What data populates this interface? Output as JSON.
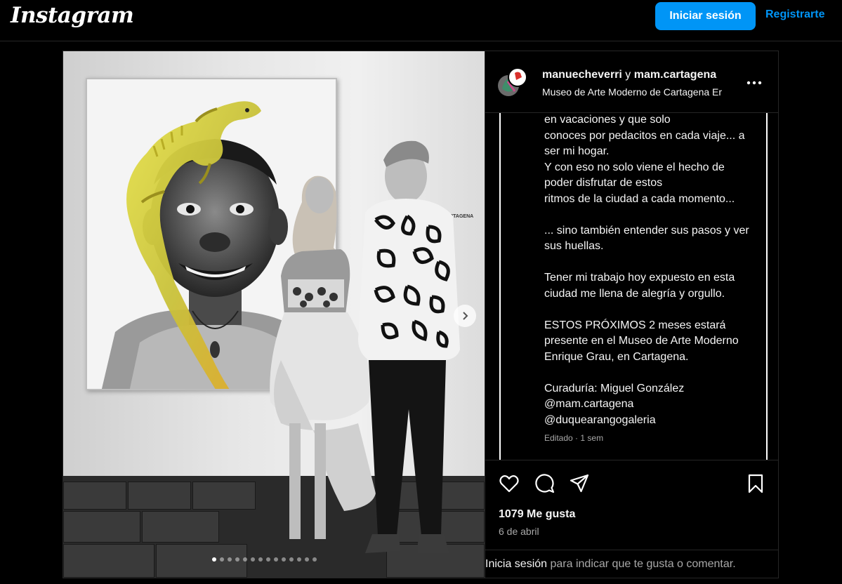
{
  "app": {
    "logo": "Instagram"
  },
  "header": {
    "login_label": "Iniciar sesión",
    "register_label": "Registrarte"
  },
  "post": {
    "author": "manuecheverri",
    "joiner": "y",
    "coauthor": "mam.cartagena",
    "location": "Museo de Arte Moderno de Cartagena Er",
    "caption_lines": [
      "en vacaciones y que solo",
      "conoces por pedacitos en cada viaje... a",
      "ser mi hogar.",
      "Y con eso no solo viene el hecho de",
      "poder disfrutar de estos",
      "ritmos de la ciudad a cada momento...",
      "",
      "... sino también entender sus pasos y ver",
      "sus huellas.",
      "",
      "Tener mi trabajo hoy expuesto en esta",
      "ciudad me llena de alegría y orgullo.",
      "",
      "ESTOS PRÓXIMOS 2 meses estará",
      "presente en el Museo de Arte Moderno",
      "Enrique Grau, en Cartagena.",
      "",
      "Curaduría: Miguel González",
      "@mam.cartagena",
      "@duquearangogaleria"
    ],
    "edited": "Editado",
    "edited_sep": "·",
    "edited_time": "1 sem",
    "likes": "1079 Me gusta",
    "date": "6 de abril",
    "carousel": {
      "count": 14,
      "active_index": 0
    },
    "placard_title": "CARTAGENA"
  },
  "footer": {
    "login_link": "Inicia sesión",
    "rest": " para indicar que te gusta o comentar."
  },
  "colors": {
    "accent": "#0095f6",
    "background": "#000000",
    "secondary_text": "#a8a8a8"
  },
  "icons": [
    "heart-icon",
    "comment-icon",
    "share-icon",
    "bookmark-icon",
    "more-icon",
    "chevron-right-icon"
  ]
}
